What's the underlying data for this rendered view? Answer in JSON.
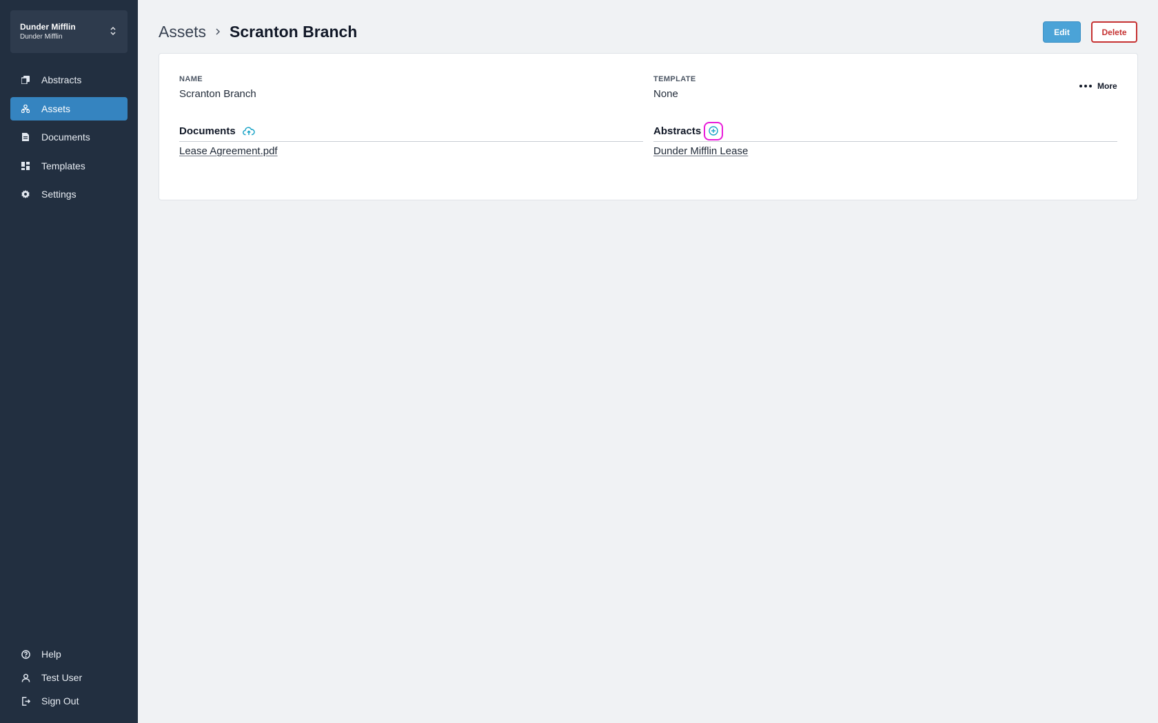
{
  "org": {
    "name": "Dunder Mifflin",
    "subtitle": "Dunder Mifflin"
  },
  "nav": [
    {
      "label": "Abstracts",
      "icon": "copy-icon",
      "active": false
    },
    {
      "label": "Assets",
      "icon": "hierarchy-icon",
      "active": true
    },
    {
      "label": "Documents",
      "icon": "document-icon",
      "active": false
    },
    {
      "label": "Templates",
      "icon": "grid-icon",
      "active": false
    },
    {
      "label": "Settings",
      "icon": "gear-icon",
      "active": false
    }
  ],
  "bottom_nav": [
    {
      "label": "Help",
      "icon": "help-icon"
    },
    {
      "label": "Test User",
      "icon": "user-icon"
    },
    {
      "label": "Sign Out",
      "icon": "sign-out-icon"
    }
  ],
  "breadcrumb": {
    "root": "Assets",
    "current": "Scranton Branch"
  },
  "actions": {
    "edit": "Edit",
    "delete": "Delete"
  },
  "detail": {
    "name_label": "NAME",
    "name_value": "Scranton Branch",
    "template_label": "TEMPLATE",
    "template_value": "None",
    "more_label": "More",
    "documents_title": "Documents",
    "documents": [
      "Lease Agreement.pdf"
    ],
    "abstracts_title": "Abstracts",
    "abstracts": [
      "Dunder Mifflin Lease"
    ]
  },
  "colors": {
    "sidebar_bg": "#222f40",
    "active_nav": "#3584c0",
    "accent": "#4ba3d7",
    "danger": "#c53030",
    "icon_teal": "#1ba4c7",
    "highlight": "#e81ad9"
  }
}
